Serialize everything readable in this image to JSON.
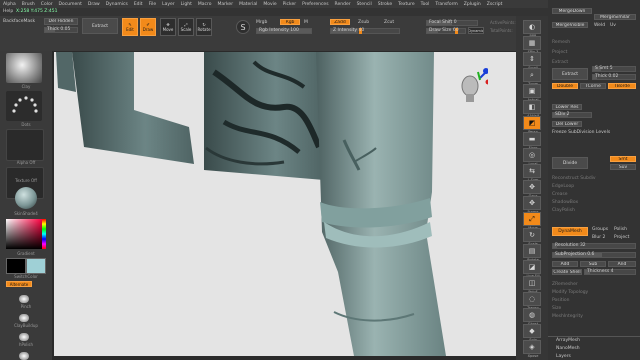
{
  "menubar": [
    "Alpha",
    "Brush",
    "Color",
    "Document",
    "Draw",
    "Dynamics",
    "Edit",
    "File",
    "Layer",
    "Light",
    "Macro",
    "Marker",
    "Material",
    "Movie",
    "Picker",
    "Preferences",
    "Render",
    "Stencil",
    "Stroke",
    "Texture",
    "Tool",
    "Transform",
    "Zplugin",
    "Zscript"
  ],
  "info": {
    "help": "Help",
    "coords": "X:258 Y:475 Z:451"
  },
  "topshelf": {
    "backface": "BackfaceMask",
    "del_hidden": "Del Hidden",
    "thick": "Thick 0.05",
    "extract": "Extract",
    "edit": "Edit",
    "draw": "Draw",
    "move": "Move",
    "scale": "Scale",
    "rotate": "Rotate",
    "mrgb": "Mrgb",
    "rgb": "Rgb",
    "m": "M",
    "rgb_intensity": "Rgb Intensity 100",
    "zadd": "Zadd",
    "zsub": "Zsub",
    "zcut": "Zcut",
    "z_intensity": "Z Intensity 40",
    "focal_shift": "Focal Shift 0",
    "draw_size": "Draw Size 60",
    "dynamic": "Dynamic",
    "active_points": "ActivePoints:",
    "total_points": "TotalPoints:"
  },
  "leftbar": {
    "brush": "Clay",
    "stroke": "Dots",
    "alpha": "Alpha Off",
    "texture": "Texture Off",
    "material": "SkinShade4",
    "gradient": "Gradient",
    "switch_color": "SwitchColor",
    "alternate": "Alternate",
    "brushes": [
      "Pinch",
      "ClayBuildup",
      "hPolish",
      "Standard"
    ]
  },
  "righttools": [
    "BPR",
    "SPix 3",
    "Scroll",
    "Zoom",
    "Actual",
    "AAHalf",
    "Persp",
    "Floor",
    "Local",
    "L.Sym",
    "Gxyz",
    "Frame",
    "Move",
    "Scale",
    "Rotate",
    "Line Fill",
    "PolyF",
    "Transp",
    "Ghost",
    "Solo",
    "Xpose"
  ],
  "rightpanel": {
    "merge_similar": "MergeSimilar",
    "merge_visible": "MergeVisible",
    "weld": "Weld",
    "uv": "Uv",
    "items_dim": [
      "Remesh",
      "Project",
      "Extract"
    ],
    "extract": "Extract",
    "s_smt": "S Smt 5",
    "thick": "Thick 0.02",
    "double": "Double",
    "tcorne": "TCorne",
    "tborder": "TBorde",
    "lower_res": "Lower Res",
    "sdiv": "SDiv 2",
    "del_lower": "Del Lower",
    "freeze": "Freeze SubDivision Levels",
    "divide": "Divide",
    "smt": "Smt",
    "suv": "Suv",
    "dim2": [
      "Reconstruct Subdiv",
      "EdgeLoop",
      "Crease",
      "ShadowBox",
      "ClayPolish"
    ],
    "dynamesh": "DynaMesh",
    "groups": "Groups",
    "polish": "Polish",
    "blur": "Blur 2",
    "project": "Project",
    "resolution": "Resolution 32",
    "subprojection": "SubProjection 0.6",
    "add": "Add",
    "sub": "Sub",
    "and": "And",
    "create_shell": "Create Shell",
    "thickness": "Thickness 4",
    "dim3": [
      "ZRemesher",
      "Modify Topology",
      "Position",
      "Size",
      "MeshIntegrity"
    ],
    "bottom": [
      "ArrayMesh",
      "NanoMesh",
      "Layers"
    ]
  }
}
